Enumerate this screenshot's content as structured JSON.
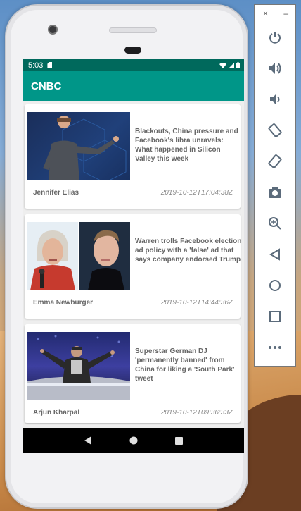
{
  "status_bar": {
    "time": "5:03"
  },
  "app_bar": {
    "title": "CNBC"
  },
  "articles": [
    {
      "title": "Blackouts, China pressure and Facebook's libra unravels: What happened in Silicon Valley this week",
      "author": "Jennifer Elias",
      "date": "2019-10-12T17:04:38Z"
    },
    {
      "title": "Warren trolls Facebook election ad policy with a 'false' ad that says company endorsed Trump",
      "author": "Emma Newburger",
      "date": "2019-10-12T14:44:36Z"
    },
    {
      "title": "Superstar German DJ 'permanently banned' from China for liking a 'South Park' tweet",
      "author": "Arjun Kharpal",
      "date": "2019-10-12T09:36:33Z"
    }
  ],
  "emulator_panel": {
    "close_glyph": "×",
    "minimize_glyph": "–",
    "tools": [
      "power-icon",
      "volume-up-icon",
      "volume-down-icon",
      "rotate-left-icon",
      "rotate-right-icon",
      "camera-icon",
      "zoom-icon",
      "back-icon",
      "home-icon",
      "overview-icon",
      "more-icon"
    ]
  },
  "colors": {
    "status_bar": "#00695c",
    "app_bar": "#009688",
    "panel_icon": "#5b6b7b"
  }
}
